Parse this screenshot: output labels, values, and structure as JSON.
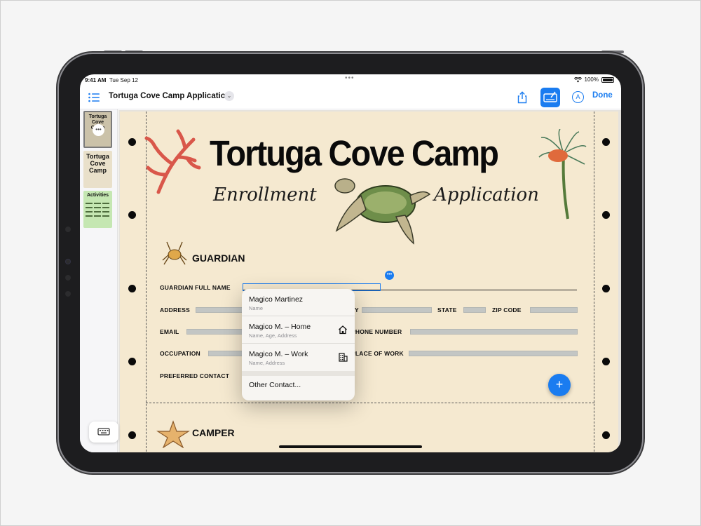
{
  "status_bar": {
    "time": "9:41 AM",
    "date": "Tue Sep 12",
    "battery": "100%"
  },
  "toolbar": {
    "title": "Tortuga Cove Camp Application",
    "done_label": "Done"
  },
  "sidebar": {
    "thumbnails": [
      {
        "title": "Tortuga Cove Camp"
      },
      {
        "title": "Tortuga Cove Camp"
      },
      {
        "title": "Activities"
      }
    ]
  },
  "document": {
    "title": "Tortuga Cove Camp",
    "subtitle_left": "Enrollment",
    "subtitle_right": "Application",
    "guardian_section": "GUARDIAN",
    "camper_section": "CAMPER",
    "fields": {
      "guardian_full_name": "GUARDIAN FULL NAME",
      "address": "ADDRESS",
      "city_tail": "Y",
      "state": "STATE",
      "zip": "ZIP CODE",
      "email": "EMAIL",
      "phone": "PHONE NUMBER",
      "occupation": "OCCUPATION",
      "place_of_work": "PLACE OF WORK",
      "preferred_contact": "PREFERRED CONTACT"
    }
  },
  "autofill_popup": {
    "items": [
      {
        "name": "Magico Martinez",
        "detail": "Name",
        "icon": ""
      },
      {
        "name": "Magico M. – Home",
        "detail": "Name, Age, Address",
        "icon": "house-icon"
      },
      {
        "name": "Magico M. – Work",
        "detail": "Name, Address",
        "icon": "building-icon"
      }
    ],
    "other_label": "Other Contact..."
  },
  "colors": {
    "accent": "#1a7cf0",
    "paper": "#f5e9d0"
  }
}
